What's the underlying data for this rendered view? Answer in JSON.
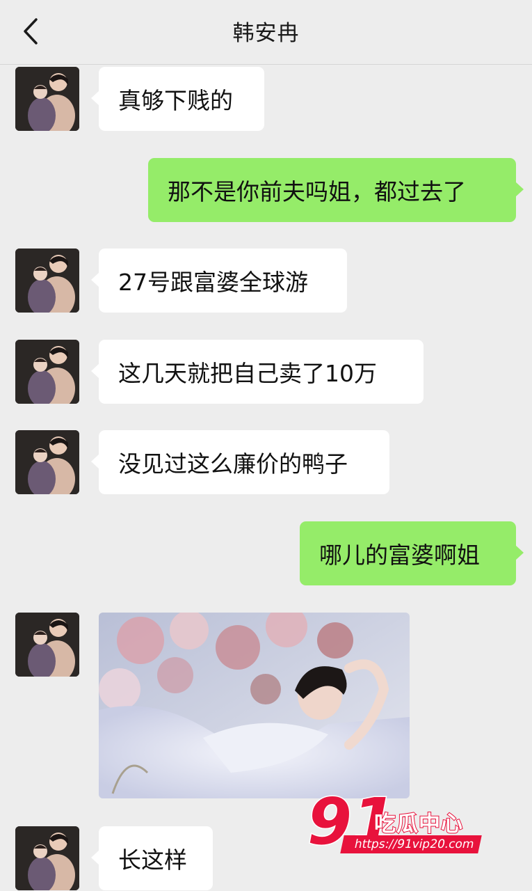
{
  "header": {
    "title": "韩安冉"
  },
  "messages": [
    {
      "side": "left",
      "type": "text",
      "text": "真够下贱的"
    },
    {
      "side": "right",
      "type": "text",
      "text": "那不是你前夫吗姐，都过去了"
    },
    {
      "side": "left",
      "type": "text",
      "text": "27号跟富婆全球游"
    },
    {
      "side": "left",
      "type": "text",
      "text": "这几天就把自己卖了10万"
    },
    {
      "side": "left",
      "type": "text",
      "text": "没见过这么廉价的鸭子"
    },
    {
      "side": "right",
      "type": "text",
      "text": "哪儿的富婆啊姐"
    },
    {
      "side": "left",
      "type": "image"
    },
    {
      "side": "left",
      "type": "text",
      "text": "长这样"
    }
  ],
  "watermark": {
    "number": "91",
    "brand": "吃瓜中心",
    "url": "https://91vip20.com"
  },
  "colors": {
    "background": "#ededed",
    "right_bubble": "#95ec69",
    "left_bubble": "#ffffff",
    "watermark": "#e8123c"
  },
  "icons": {
    "back": "chevron-left-icon"
  }
}
